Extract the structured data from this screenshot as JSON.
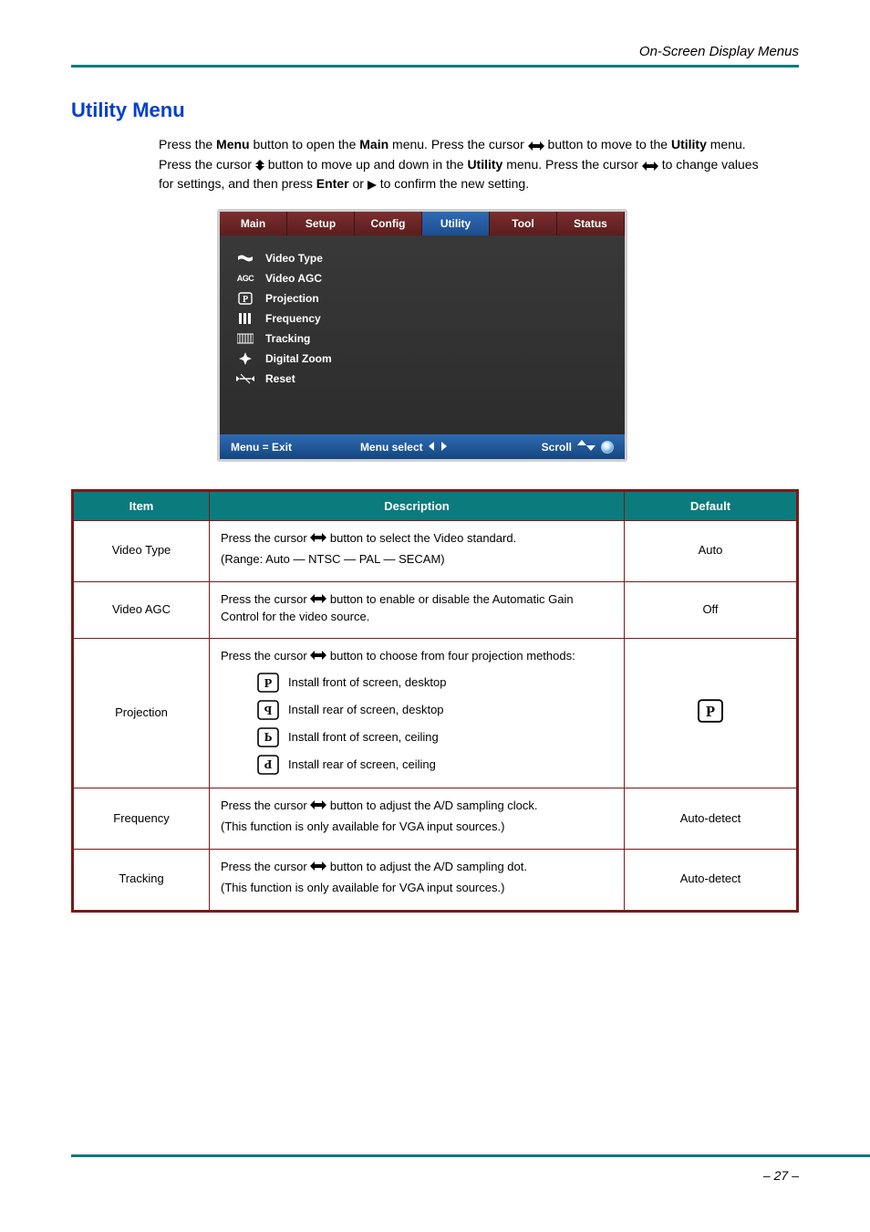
{
  "header": {
    "right_text": "On-Screen Display Menus"
  },
  "section": {
    "title": "Utility Menu"
  },
  "instructions": {
    "line1_pre": "Press the ",
    "menu_b": "Menu",
    "line1_mid": " button to open the ",
    "main_b": "Main",
    "line1_after_main": " menu. Press the cursor ",
    "line1_after_lr": " button to move to the ",
    "utility_b": "Utility",
    "line1_end": " menu. Press the cursor ",
    "line2_pre": " button to move up and down in the ",
    "line2_utility": "Utility",
    "line2_mid": " menu. Press the cursor ",
    "line2_end": " to change values for settings, and then press ",
    "enter_b": "Enter",
    "line3_or": " or ",
    "line3_end": " to confirm the new setting."
  },
  "osd": {
    "tabs": [
      "Main",
      "Setup",
      "Config",
      "Utility",
      "Tool",
      "Status"
    ],
    "selected_tab": "Utility",
    "items": [
      "Video Type",
      "Video AGC",
      "Projection",
      "Frequency",
      "Tracking",
      "Digital Zoom",
      "Reset"
    ],
    "foot_left": "Menu = Exit",
    "foot_mid": "Menu select",
    "foot_right": "Scroll"
  },
  "table": {
    "headers": [
      "Item",
      "Description",
      "Default"
    ],
    "rows": [
      {
        "item": "Video Type",
        "desc_pre": "Press the cursor ",
        "desc_post": " button to select the Video standard.",
        "desc_note": "(Range: Auto — NTSC — PAL — SECAM)",
        "def": "Auto"
      },
      {
        "item": "Video AGC",
        "desc_pre": "Press the cursor ",
        "desc_post": " button to enable or disable the Automatic Gain Control for the video source.",
        "def": "Off"
      },
      {
        "item": "Projection",
        "desc_pre": "Press the cursor ",
        "desc_post": " button to choose from four projection methods:",
        "options": [
          " Install front of screen, desktop",
          " Install rear of screen, desktop",
          " Install front of screen, ceiling",
          " Install rear of screen, ceiling"
        ],
        "def": ""
      },
      {
        "item": "Frequency",
        "desc_pre": "Press the cursor ",
        "desc_post": " button to adjust the A/D sampling clock.",
        "desc_note": "(This function is only available for VGA input sources.)",
        "def": "Auto-detect"
      },
      {
        "item": "Tracking",
        "desc_pre": "Press the cursor ",
        "desc_post": " button to adjust the A/D sampling dot.",
        "desc_note": "(This function is only available for VGA input sources.)",
        "def": "Auto-detect"
      }
    ]
  },
  "footer": {
    "em1": "–",
    "pg": "27",
    "em2": "–"
  }
}
